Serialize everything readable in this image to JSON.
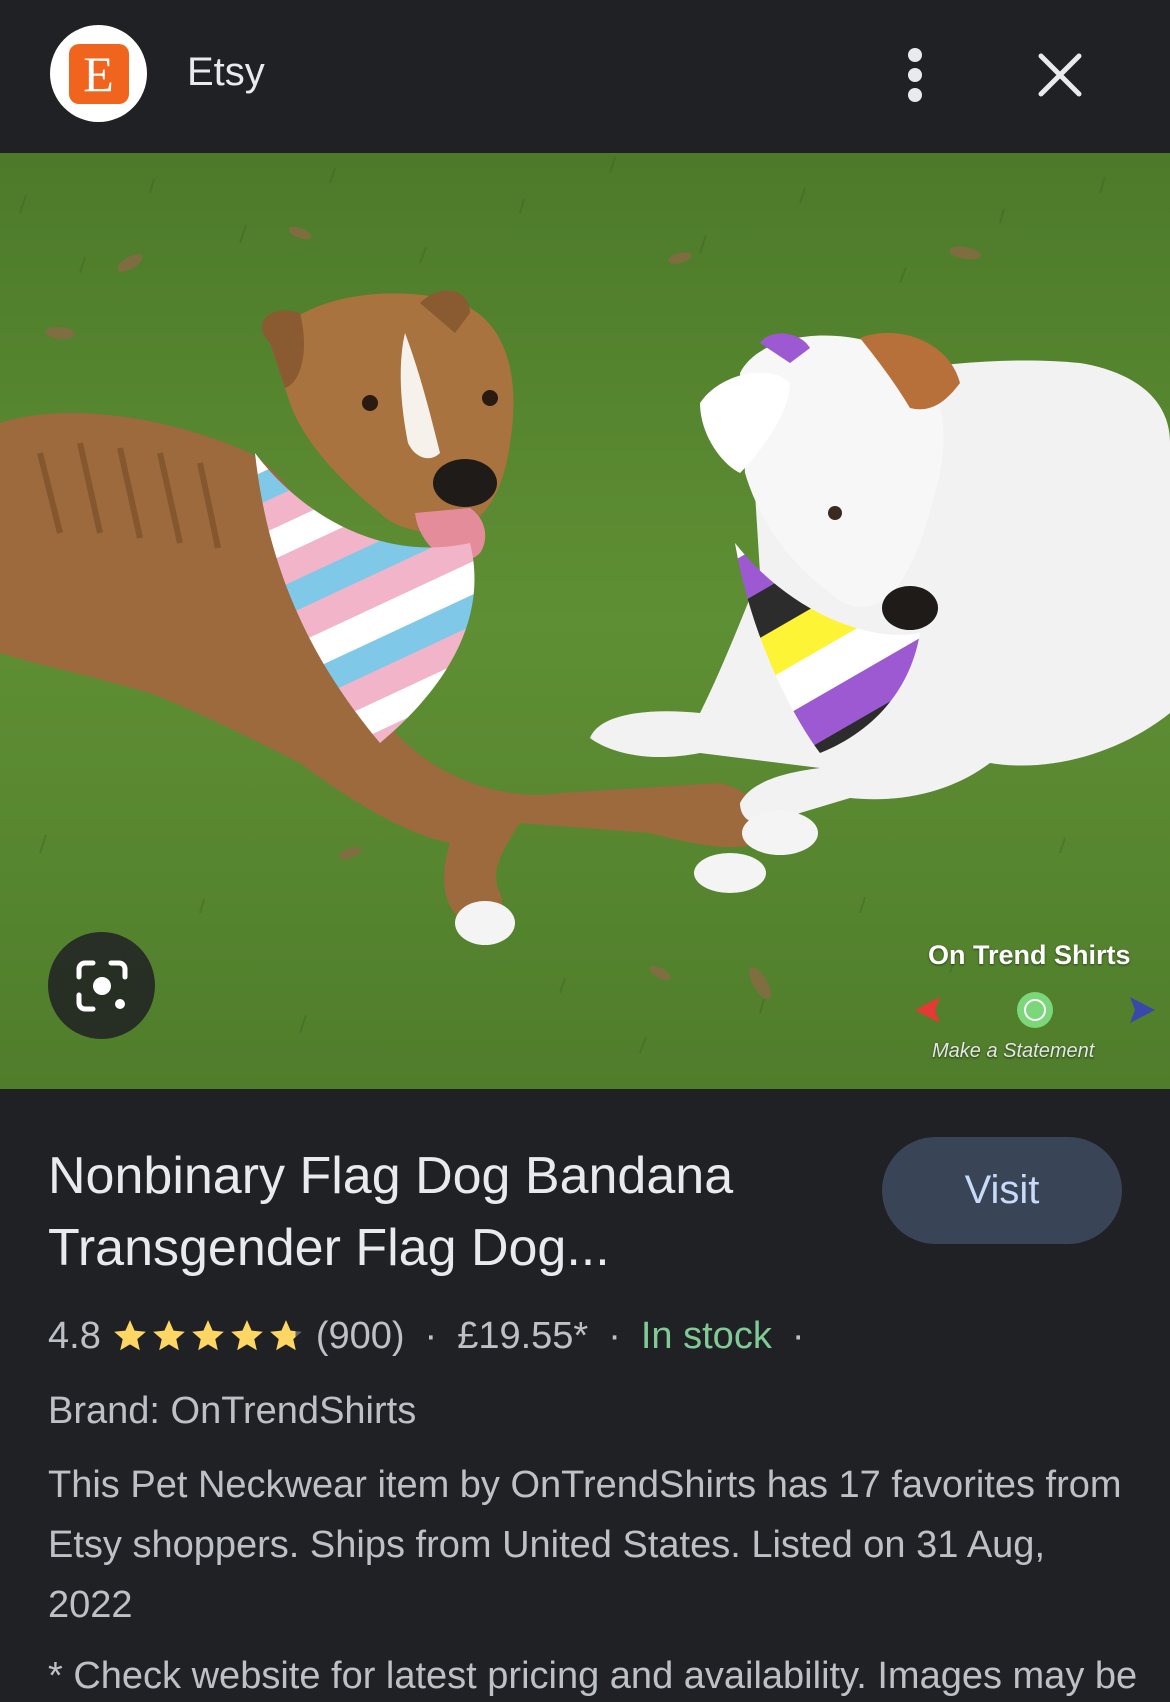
{
  "header": {
    "logo_letter": "E",
    "site_name": "Etsy",
    "menu_icon": "more-vert-icon",
    "close_icon": "close-icon"
  },
  "image": {
    "alt": "Two dogs lying on grass wearing pride flag bandanas",
    "lens_icon": "lens-search-icon",
    "watermark_title": "On Trend Shirts",
    "watermark_tagline": "Make a Statement"
  },
  "product": {
    "title_line1": "Nonbinary Flag Dog Bandana",
    "title_line2": "Transgender Flag Dog...",
    "visit_label": "Visit",
    "rating": "4.8",
    "rating_value": 4.8,
    "rating_max": 5,
    "review_count": "(900)",
    "separator": "·",
    "price": "£19.55*",
    "stock": "In stock",
    "brand": "Brand: OnTrendShirts",
    "description": "This Pet Neckwear item by OnTrendShirts has 17 favorites from Etsy shoppers. Ships from United States. Listed on 31 Aug, 2022",
    "footnote": "* Check website for latest pricing and availability. Images may be"
  },
  "colors": {
    "background": "#202124",
    "brand": "#f1641e",
    "visit_button": "#394457",
    "in_stock": "#81c995",
    "star": "#fdd663"
  }
}
